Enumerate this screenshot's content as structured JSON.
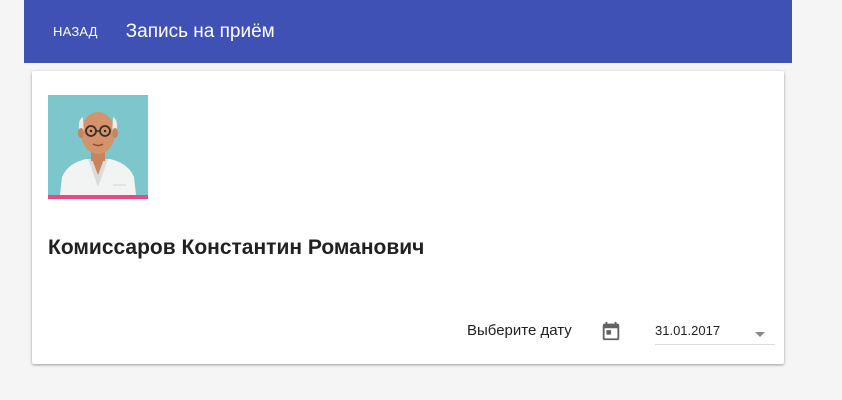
{
  "toolbar": {
    "back_label": "НАЗАД",
    "title": "Запись на приём",
    "color": "#3f51b5"
  },
  "doctor": {
    "name": "Комиссаров Константин Романович",
    "avatar_icon": "doctor-avatar-icon"
  },
  "date_picker": {
    "label": "Выберите дату",
    "icon": "calendar-icon",
    "value": "31.01.2017"
  },
  "colors": {
    "accent_underline": "#e84a7f",
    "avatar_background": "#7cc6cc"
  }
}
